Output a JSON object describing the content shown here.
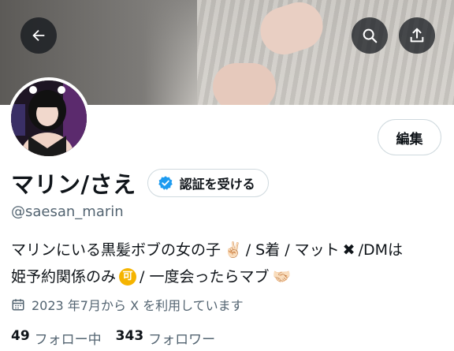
{
  "header": {
    "back_icon": "arrow-left-icon",
    "search_icon": "search-icon",
    "share_icon": "share-icon"
  },
  "profile": {
    "edit_label": "編集",
    "display_name": "マリン/さえ",
    "verify_label": "認証を受ける",
    "verify_color": "#1d9bf0",
    "handle": "@saesan_marin",
    "bio_line1": {
      "part1": "マリンにいる黒髪ボブの女の子",
      "emoji1": "✌🏻",
      "part2": " / S着 / マット",
      "emoji2": "✖",
      "part3": " /DMは"
    },
    "bio_line2": {
      "part1": "姫予約関係のみ",
      "emoji1": "可",
      "part2": " / 一度会ったらマブ",
      "emoji2": "🤝🏻"
    },
    "joined_icon": "calendar-icon",
    "joined_text": "2023 年7月から X を利用しています",
    "following_count": "49",
    "following_label": "フォロー中",
    "followers_count": "343",
    "followers_label": "フォロワー"
  }
}
